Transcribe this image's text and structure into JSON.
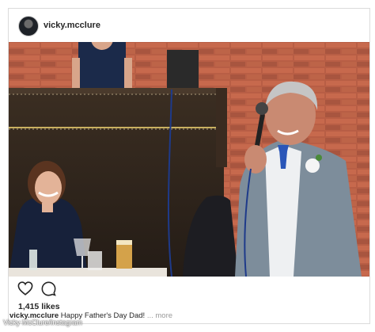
{
  "post": {
    "username": "vicky.mcclure",
    "likes": "1,415 likes",
    "caption_user": "vicky.mcclure",
    "caption_text": "Happy Father's Day Dad!",
    "caption_more": "... more",
    "credit": "Vicky McClure/Instagram"
  },
  "icons": {
    "like": "heart-icon",
    "comment": "comment-icon"
  },
  "colors": {
    "text": "#262626",
    "border": "#dbdbdb",
    "more": "#999999"
  }
}
